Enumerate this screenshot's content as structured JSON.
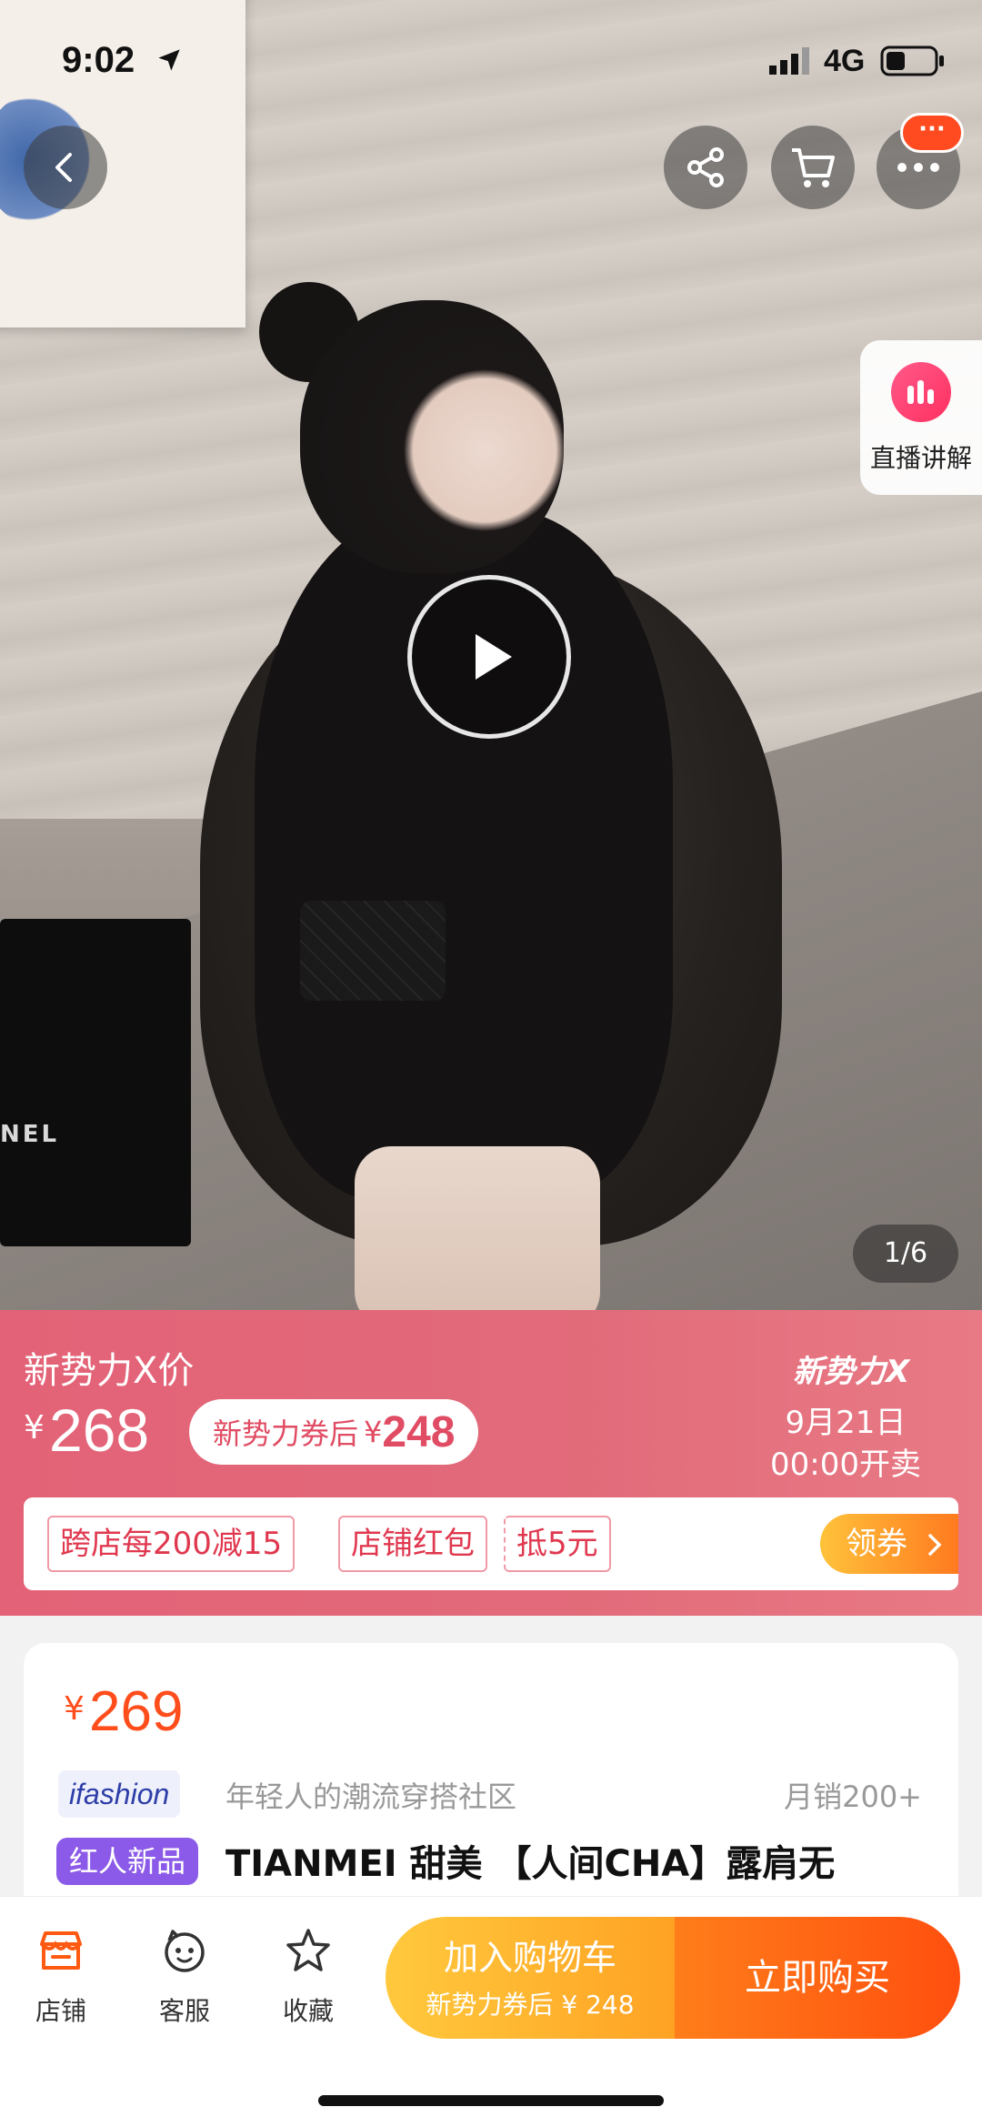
{
  "status_bar": {
    "time": "9:02",
    "network": "4G"
  },
  "hero": {
    "live_label": "直播讲解",
    "pager": "1/6",
    "bag_brand_text": "NEL"
  },
  "nav": {
    "more_badge": "···"
  },
  "promo": {
    "label": "新势力X价",
    "price_symbol": "¥",
    "price": "268",
    "coupon_text": "新势力券后",
    "coupon_symbol": "¥",
    "coupon_price": "248",
    "brand": "新势力X",
    "date": "9月21日",
    "open_time": "00:00开卖",
    "coupons": {
      "cross_store": "跨店每200减15",
      "store_red": "店铺红包",
      "deduct": "抵5元",
      "get": "领券"
    }
  },
  "product": {
    "price_symbol": "¥",
    "price": "269",
    "brand_tag": "ifashion",
    "slogan": "年轻人的潮流穿搭社区",
    "sales": "月销200+",
    "new_tag": "红人新品",
    "title": "TIANMEI 甜美 【人间CHA】露肩无"
  },
  "bottom_bar": {
    "store": "店铺",
    "service": "客服",
    "favorite": "收藏",
    "add_cart": "加入购物车",
    "add_cart_sub": "新势力券后 ¥ 248",
    "buy_now": "立即购买"
  },
  "colors": {
    "accent": "#ff4d1c",
    "promo_band": "#e36277",
    "add_cart": "#ffb52e",
    "buy_now": "#ff5a12"
  }
}
